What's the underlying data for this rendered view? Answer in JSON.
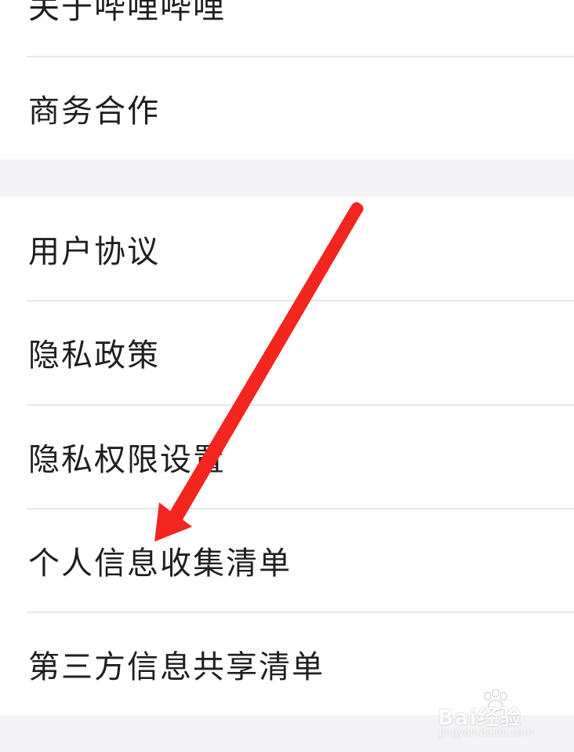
{
  "menu": {
    "group1": [
      {
        "label": "关于哔哩哔哩"
      },
      {
        "label": "商务合作"
      }
    ],
    "group2": [
      {
        "label": "用户协议"
      },
      {
        "label": "隐私政策"
      },
      {
        "label": "隐私权限设置"
      },
      {
        "label": "个人信息收集清单"
      },
      {
        "label": "第三方信息共享清单"
      }
    ]
  },
  "annotation": {
    "arrow_color": "#f2261f",
    "points_to": "个人信息收集清单"
  },
  "watermark": {
    "text": "Bai经验",
    "sub": "jingyan.baidu.com",
    "icon": "paw-icon"
  },
  "colors": {
    "background": "#f4f4f6",
    "row_background": "#ffffff",
    "text": "#1f1f1f",
    "divider": "#e6e6e8"
  }
}
